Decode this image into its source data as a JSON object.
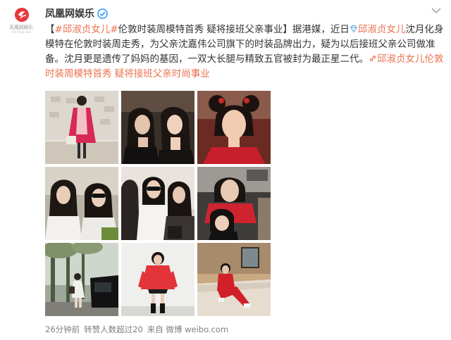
{
  "account": {
    "name": "凤凰网娱乐",
    "avatar_caption": "凤凰网娱乐",
    "avatar_sub": "ent.ifeng.com"
  },
  "post": {
    "segments": [
      {
        "type": "topic",
        "text": "#邱淑贞女儿#"
      },
      {
        "type": "text",
        "text": "伦敦时装周模特首秀 疑将接班父亲事业】据港媒，近日"
      },
      {
        "type": "mention",
        "text": "邱淑贞女儿"
      },
      {
        "type": "text",
        "text": "沈月化身模特在伦敦时装周走秀，为父亲沈嘉伟公司旗下的时装品牌出力，疑为以后接班父亲公司做准备。沈月更是遗传了妈妈的基因，一双大长腿与精致五官被封为最正星二代。"
      },
      {
        "type": "link",
        "text": "邱淑贞女儿伦敦时装周模特首秀 疑将接班父亲时尚事业"
      }
    ],
    "lead_bracket": "【"
  },
  "photos": [
    {
      "label": "photo-1-red-coat-runway"
    },
    {
      "label": "photo-2-two-women-selfie"
    },
    {
      "label": "photo-3-red-costume-portrait"
    },
    {
      "label": "photo-4-two-women-sunglasses"
    },
    {
      "label": "photo-5-group-sunglasses"
    },
    {
      "label": "photo-6-red-top-mother-daughter"
    },
    {
      "label": "photo-7-street-car"
    },
    {
      "label": "photo-8-red-jacket-white-wall"
    },
    {
      "label": "photo-9-red-tracksuit-sofa"
    }
  ],
  "footer": {
    "time": "26分钟前",
    "reposts": "转赞人数超过20",
    "source": "来自 微博 weibo.com"
  },
  "colors": {
    "accent": "#eb7350",
    "name": "#333333",
    "meta": "#808080",
    "verified": "#1e90ff"
  }
}
